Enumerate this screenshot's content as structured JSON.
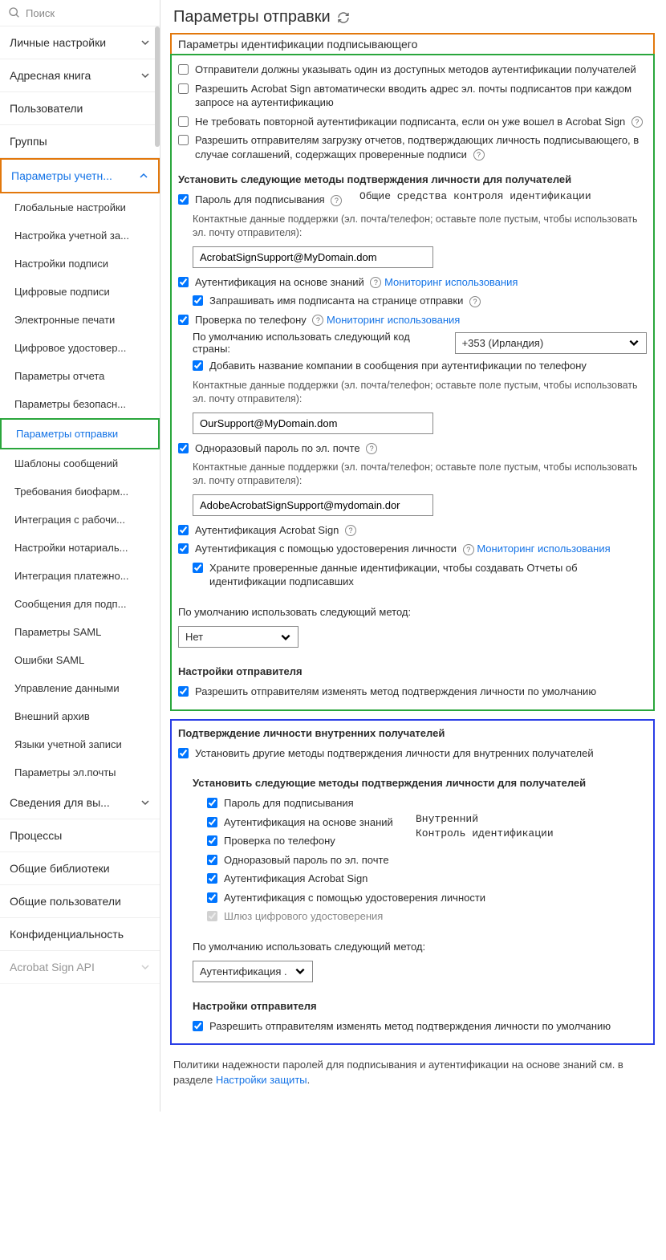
{
  "search": {
    "placeholder": "Поиск"
  },
  "nav": {
    "personal": "Личные настройки",
    "addressbook": "Адресная книга",
    "users": "Пользователи",
    "groups": "Группы",
    "account_params": "Параметры учетн...",
    "sub": {
      "global": "Глобальные настройки",
      "account_setup": "Настройка учетной за...",
      "sig_settings": "Настройки подписи",
      "digital_sigs": "Цифровые подписи",
      "eseals": "Электронные печати",
      "digital_id": "Цифровое удостовер...",
      "report_params": "Параметры отчета",
      "security_params": "Параметры безопасн...",
      "send_params": "Параметры отправки",
      "msg_templates": "Шаблоны сообщений",
      "biopharm": "Требования биофарм...",
      "workflow_int": "Интеграция с рабочи...",
      "notary": "Настройки нотариаль...",
      "payment_int": "Интеграция платежно...",
      "signer_msgs": "Сообщения для подп...",
      "saml_params": "Параметры SAML",
      "saml_errors": "Ошибки SAML",
      "data_mgmt": "Управление данными",
      "ext_archive": "Внешний архив",
      "account_langs": "Языки учетной записи",
      "email_params": "Параметры эл.почты"
    },
    "insights": "Сведения для вы...",
    "processes": "Процессы",
    "shared_libs": "Общие библиотеки",
    "shared_users": "Общие пользователи",
    "privacy": "Конфиденциальность",
    "acrobat_api": "Acrobat Sign API"
  },
  "page": {
    "title": "Параметры отправки"
  },
  "signer_id": {
    "heading": "Параметры идентификации подписывающего",
    "opt1": "Отправители должны указывать один из доступных методов аутентификации получателей",
    "opt2": "Разрешить Acrobat Sign автоматически вводить адрес эл. почты подписантов при каждом запросе на аутентификацию",
    "opt3": "Не требовать повторной аутентификации подписанта, если он уже вошел в Acrobat Sign",
    "opt4": "Разрешить отправителям загрузку отчетов, подтверждающих личность подписывающего, в случае соглашений, содержащих проверенные подписи",
    "methods_heading": "Установить следующие методы подтверждения личности для получателей",
    "overlay_general": "Общие средства контроля идентификации",
    "sign_password": "Пароль для подписывания",
    "support_contact_note": "Контактные данные поддержки (эл. почта/телефон; оставьте поле пустым, чтобы использовать эл. почту отправителя):",
    "support_value1": "AcrobatSignSupport@MyDomain.dom",
    "kba": "Аутентификация на основе знаний",
    "usage_monitoring": "Мониторинг использования",
    "request_signer_name": "Запрашивать имя подписанта на странице отправки",
    "phone_verify": "Проверка по телефону",
    "default_country_label": "По умолчанию использовать следующий код страны:",
    "country_value": "+353 (Ирландия)",
    "add_company_phone": "Добавить название компании в сообщения при аутентификации по телефону",
    "support_value2": "OurSupport@MyDomain.dom",
    "email_otp": "Одноразовый пароль по эл. почте",
    "support_value3": "AdobeAcrobatSignSupport@mydomain.dor",
    "acrobat_auth": "Аутентификация Acrobat Sign",
    "gov_id_auth": "Аутентификация с помощью удостоверения личности",
    "store_id_data": "Храните проверенные данные идентификации, чтобы создавать Отчеты об идентификации подписавших",
    "default_method_label": "По умолчанию использовать следующий метод:",
    "default_method_value": "Нет",
    "sender_settings": "Настройки отправителя",
    "allow_sender_change": "Разрешить отправителям изменять метод подтверждения личности по умолчанию"
  },
  "internal": {
    "heading": "Подтверждение личности внутренних получателей",
    "set_other": "Установить другие методы подтверждения личности для внутренних получателей",
    "methods_heading": "Установить следующие методы подтверждения личности для получателей",
    "overlay_internal_1": "Внутренний",
    "overlay_internal_2": "Контроль идентификации",
    "sign_password": "Пароль для подписывания",
    "kba": "Аутентификация на основе знаний",
    "phone": "Проверка по телефону",
    "email_otp": "Одноразовый пароль по эл. почте",
    "acrobat_auth": "Аутентификация Acrobat Sign",
    "gov_id": "Аутентификация с помощью удостоверения личности",
    "digital_gateway": "Шлюз цифрового удостоверения",
    "default_method_label": "По умолчанию использовать следующий метод:",
    "default_method_value": "Аутентификация .",
    "sender_settings": "Настройки отправителя",
    "allow_sender_change": "Разрешить отправителям изменять метод подтверждения личности по умолчанию"
  },
  "footer": {
    "text": "Политики надежности паролей для подписывания и аутентификации на основе знаний см. в разделе ",
    "link": "Настройки защиты",
    "period": "."
  }
}
